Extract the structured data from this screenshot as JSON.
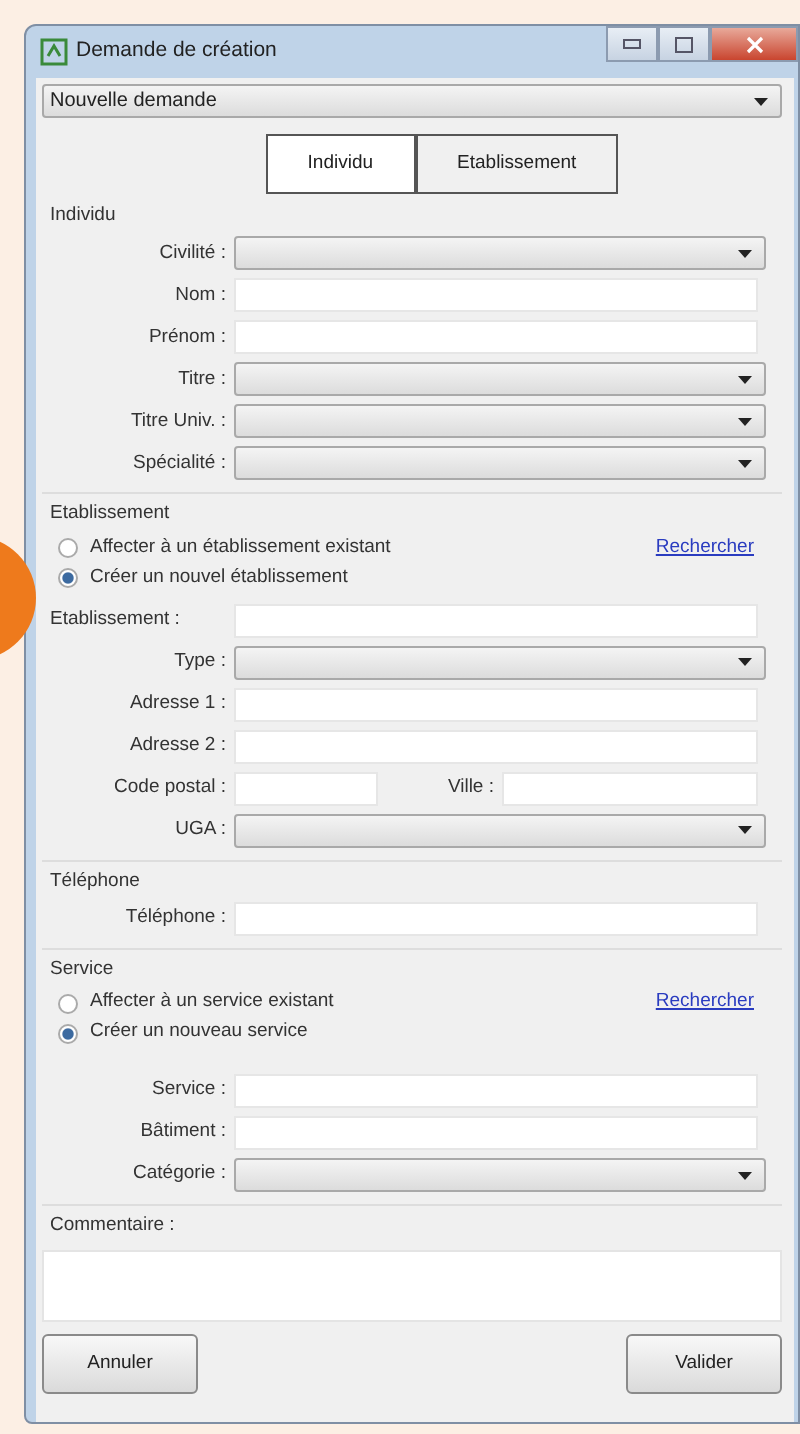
{
  "window": {
    "title": "Demande de création"
  },
  "request_type": {
    "value": "Nouvelle demande"
  },
  "tabs": [
    {
      "label": "Individu",
      "selected": true
    },
    {
      "label": "Etablissement",
      "selected": false
    }
  ],
  "sections": [
    {
      "title": "Individu",
      "fields": [
        {
          "label": "Civilité :",
          "kind": "combo"
        },
        {
          "label": "Nom :",
          "kind": "text"
        },
        {
          "label": "Prénom :",
          "kind": "text"
        },
        {
          "label": "Titre :",
          "kind": "combo"
        },
        {
          "label": "Titre Univ. :",
          "kind": "combo"
        },
        {
          "label": "Spécialité :",
          "kind": "combo"
        }
      ]
    },
    {
      "title": "Etablissement",
      "options": [
        {
          "label": "Affecter à un établissement existant",
          "selected": false
        },
        {
          "label": "Créer un nouvel établissement",
          "selected": true
        }
      ],
      "link": "Rechercher",
      "fields": [
        {
          "label": "Etablissement :",
          "kind": "wide"
        },
        {
          "label": "Type :",
          "kind": "combo"
        },
        {
          "label": "Adresse 1 :",
          "kind": "text"
        },
        {
          "label": "Adresse 2 :",
          "kind": "text"
        },
        {
          "label": "Code postal :",
          "kind": "pair",
          "label_2": "Ville :"
        },
        {
          "label": "UGA :",
          "kind": "combo"
        }
      ]
    },
    {
      "title": "Téléphone",
      "fields": [
        {
          "label": "Téléphone :",
          "kind": "text"
        }
      ]
    },
    {
      "title": "Service",
      "options": [
        {
          "label": "Affecter à un service existant",
          "selected": false
        },
        {
          "label": "Créer un nouveau service",
          "selected": true
        }
      ],
      "link": "Rechercher",
      "fields": [
        {
          "label": "Service :",
          "kind": "text"
        },
        {
          "label": "Bâtiment :",
          "kind": "text"
        },
        {
          "label": "Catégorie :",
          "kind": "combo"
        }
      ]
    }
  ],
  "comment": {
    "label": "Commentaire :"
  },
  "buttons": [
    {
      "label": "Annuler"
    },
    {
      "label": "Valider"
    }
  ]
}
